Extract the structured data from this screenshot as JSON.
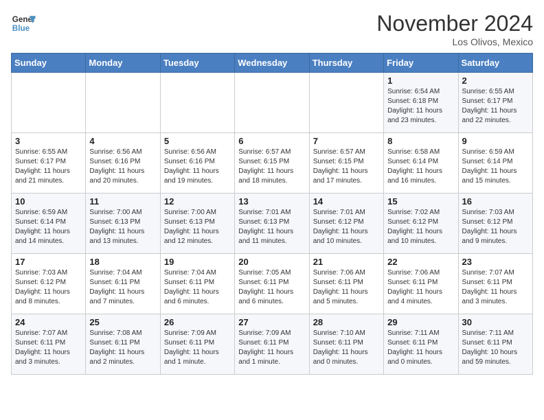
{
  "header": {
    "logo_line1": "General",
    "logo_line2": "Blue",
    "month": "November 2024",
    "location": "Los Olivos, Mexico"
  },
  "days_of_week": [
    "Sunday",
    "Monday",
    "Tuesday",
    "Wednesday",
    "Thursday",
    "Friday",
    "Saturday"
  ],
  "weeks": [
    [
      {
        "day": "",
        "info": ""
      },
      {
        "day": "",
        "info": ""
      },
      {
        "day": "",
        "info": ""
      },
      {
        "day": "",
        "info": ""
      },
      {
        "day": "",
        "info": ""
      },
      {
        "day": "1",
        "info": "Sunrise: 6:54 AM\nSunset: 6:18 PM\nDaylight: 11 hours\nand 23 minutes."
      },
      {
        "day": "2",
        "info": "Sunrise: 6:55 AM\nSunset: 6:17 PM\nDaylight: 11 hours\nand 22 minutes."
      }
    ],
    [
      {
        "day": "3",
        "info": "Sunrise: 6:55 AM\nSunset: 6:17 PM\nDaylight: 11 hours\nand 21 minutes."
      },
      {
        "day": "4",
        "info": "Sunrise: 6:56 AM\nSunset: 6:16 PM\nDaylight: 11 hours\nand 20 minutes."
      },
      {
        "day": "5",
        "info": "Sunrise: 6:56 AM\nSunset: 6:16 PM\nDaylight: 11 hours\nand 19 minutes."
      },
      {
        "day": "6",
        "info": "Sunrise: 6:57 AM\nSunset: 6:15 PM\nDaylight: 11 hours\nand 18 minutes."
      },
      {
        "day": "7",
        "info": "Sunrise: 6:57 AM\nSunset: 6:15 PM\nDaylight: 11 hours\nand 17 minutes."
      },
      {
        "day": "8",
        "info": "Sunrise: 6:58 AM\nSunset: 6:14 PM\nDaylight: 11 hours\nand 16 minutes."
      },
      {
        "day": "9",
        "info": "Sunrise: 6:59 AM\nSunset: 6:14 PM\nDaylight: 11 hours\nand 15 minutes."
      }
    ],
    [
      {
        "day": "10",
        "info": "Sunrise: 6:59 AM\nSunset: 6:14 PM\nDaylight: 11 hours\nand 14 minutes."
      },
      {
        "day": "11",
        "info": "Sunrise: 7:00 AM\nSunset: 6:13 PM\nDaylight: 11 hours\nand 13 minutes."
      },
      {
        "day": "12",
        "info": "Sunrise: 7:00 AM\nSunset: 6:13 PM\nDaylight: 11 hours\nand 12 minutes."
      },
      {
        "day": "13",
        "info": "Sunrise: 7:01 AM\nSunset: 6:13 PM\nDaylight: 11 hours\nand 11 minutes."
      },
      {
        "day": "14",
        "info": "Sunrise: 7:01 AM\nSunset: 6:12 PM\nDaylight: 11 hours\nand 10 minutes."
      },
      {
        "day": "15",
        "info": "Sunrise: 7:02 AM\nSunset: 6:12 PM\nDaylight: 11 hours\nand 10 minutes."
      },
      {
        "day": "16",
        "info": "Sunrise: 7:03 AM\nSunset: 6:12 PM\nDaylight: 11 hours\nand 9 minutes."
      }
    ],
    [
      {
        "day": "17",
        "info": "Sunrise: 7:03 AM\nSunset: 6:12 PM\nDaylight: 11 hours\nand 8 minutes."
      },
      {
        "day": "18",
        "info": "Sunrise: 7:04 AM\nSunset: 6:11 PM\nDaylight: 11 hours\nand 7 minutes."
      },
      {
        "day": "19",
        "info": "Sunrise: 7:04 AM\nSunset: 6:11 PM\nDaylight: 11 hours\nand 6 minutes."
      },
      {
        "day": "20",
        "info": "Sunrise: 7:05 AM\nSunset: 6:11 PM\nDaylight: 11 hours\nand 6 minutes."
      },
      {
        "day": "21",
        "info": "Sunrise: 7:06 AM\nSunset: 6:11 PM\nDaylight: 11 hours\nand 5 minutes."
      },
      {
        "day": "22",
        "info": "Sunrise: 7:06 AM\nSunset: 6:11 PM\nDaylight: 11 hours\nand 4 minutes."
      },
      {
        "day": "23",
        "info": "Sunrise: 7:07 AM\nSunset: 6:11 PM\nDaylight: 11 hours\nand 3 minutes."
      }
    ],
    [
      {
        "day": "24",
        "info": "Sunrise: 7:07 AM\nSunset: 6:11 PM\nDaylight: 11 hours\nand 3 minutes."
      },
      {
        "day": "25",
        "info": "Sunrise: 7:08 AM\nSunset: 6:11 PM\nDaylight: 11 hours\nand 2 minutes."
      },
      {
        "day": "26",
        "info": "Sunrise: 7:09 AM\nSunset: 6:11 PM\nDaylight: 11 hours\nand 1 minute."
      },
      {
        "day": "27",
        "info": "Sunrise: 7:09 AM\nSunset: 6:11 PM\nDaylight: 11 hours\nand 1 minute."
      },
      {
        "day": "28",
        "info": "Sunrise: 7:10 AM\nSunset: 6:11 PM\nDaylight: 11 hours\nand 0 minutes."
      },
      {
        "day": "29",
        "info": "Sunrise: 7:11 AM\nSunset: 6:11 PM\nDaylight: 11 hours\nand 0 minutes."
      },
      {
        "day": "30",
        "info": "Sunrise: 7:11 AM\nSunset: 6:11 PM\nDaylight: 10 hours\nand 59 minutes."
      }
    ]
  ]
}
